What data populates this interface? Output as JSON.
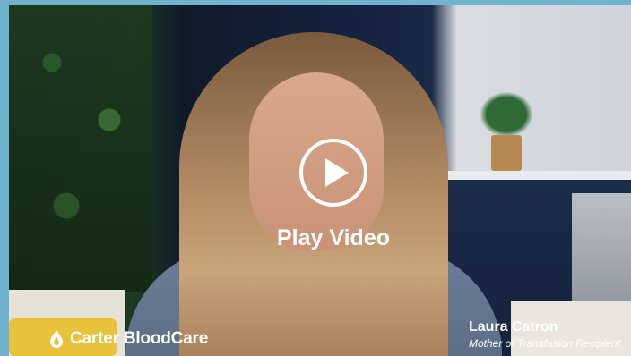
{
  "video": {
    "play_label": "Play Video",
    "brand_name": "Carter BloodCare",
    "speaker_name": "Laura Catron",
    "speaker_role": "Mother of Transfusion Recipient"
  },
  "colors": {
    "frame_background": "#6fb3cf",
    "overlay_text": "#ffffff"
  },
  "icons": {
    "play": "play-icon",
    "logo": "blood-drop-icon"
  }
}
